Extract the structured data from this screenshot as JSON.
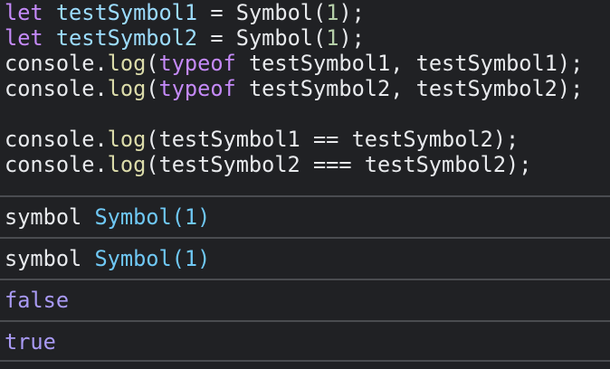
{
  "code": {
    "lines": [
      {
        "kw": "let",
        "var": "testSymbol1",
        "eq": "=",
        "fn": "Symbol",
        "num": "1"
      },
      {
        "kw": "let",
        "var": "testSymbol2",
        "eq": "=",
        "fn": "Symbol",
        "num": "1"
      },
      {
        "obj": "console",
        "method": "log",
        "kw": "typeof",
        "arg1": "testSymbol1",
        "arg2": "testSymbol1"
      },
      {
        "obj": "console",
        "method": "log",
        "kw": "typeof",
        "arg1": "testSymbol2",
        "arg2": "testSymbol2"
      },
      {
        "obj": "console",
        "method": "log",
        "expr": "testSymbol1 == testSymbol2"
      },
      {
        "obj": "console",
        "method": "log",
        "expr": "testSymbol2 === testSymbol2"
      }
    ]
  },
  "output": {
    "rows": [
      {
        "type": "symbol",
        "value": "Symbol(1)"
      },
      {
        "type": "symbol",
        "value": "Symbol(1)"
      },
      {
        "value": "false"
      },
      {
        "value": "true"
      }
    ]
  }
}
